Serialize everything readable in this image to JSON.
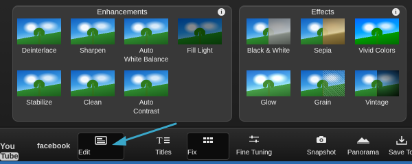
{
  "enhancements": {
    "title": "Enhancements",
    "items": [
      {
        "label": "Deinterlace"
      },
      {
        "label": "Sharpen"
      },
      {
        "label": "Auto",
        "label2": "White Balance"
      },
      {
        "label": "Fill Light"
      },
      {
        "label": "Stabilize"
      },
      {
        "label": "Clean"
      },
      {
        "label": "Auto",
        "label2": "Contrast"
      }
    ]
  },
  "effects": {
    "title": "Effects",
    "items": [
      {
        "label": "Black & White"
      },
      {
        "label": "Sepia"
      },
      {
        "label": "Vivid Colors"
      },
      {
        "label": "Glow"
      },
      {
        "label": "Grain"
      },
      {
        "label": "Vintage"
      }
    ]
  },
  "toolbar": {
    "youtube": "You",
    "youtube_tube": "Tube",
    "facebook": "facebook",
    "edit": "Edit",
    "titles": "Titles",
    "fix": "Fix",
    "fine_tuning": "Fine Tuning",
    "snapshot": "Snapshot",
    "panorama": "Panorama",
    "save_to": "Save To"
  },
  "info_glyph": "i",
  "colors": {
    "accent_arrow": "#3aa7c9",
    "bottom_strip": "#2b6cb0"
  }
}
